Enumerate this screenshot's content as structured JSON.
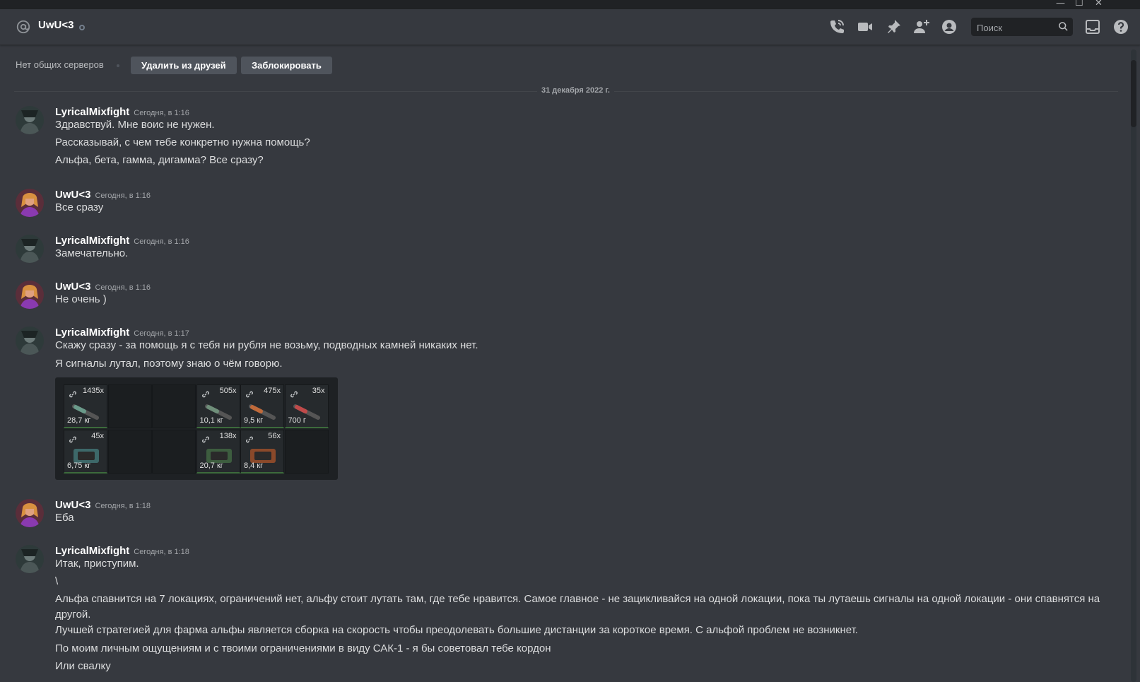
{
  "window": {
    "minimize": "—",
    "maximize": "☐",
    "close": "✕"
  },
  "header": {
    "channel_name": "UwU<3",
    "search_placeholder": "Поиск",
    "icons": [
      "at-icon",
      "call-icon",
      "video-icon",
      "pin-icon",
      "add-friend-icon",
      "profile-icon",
      "search-icon",
      "inbox-icon",
      "help-icon"
    ]
  },
  "profile_bar": {
    "no_servers": "Нет общих серверов",
    "remove_friend": "Удалить из друзей",
    "block": "Заблокировать"
  },
  "date_divider": "31 декабря 2022 г.",
  "messages": [
    {
      "author": "LyricalMixfight",
      "timestamp": "Сегодня, в 1:16",
      "lines": [
        "Здравствуй. Мне воис не нужен.",
        "Рассказывай, с чем тебе конкретно нужна помощь?",
        "Альфа, бета, гамма, дигамма? Все сразу?"
      ]
    },
    {
      "author": "UwU<3",
      "timestamp": "Сегодня, в 1:16",
      "lines": [
        "Все сразу"
      ]
    },
    {
      "author": "LyricalMixfight",
      "timestamp": "Сегодня, в 1:16",
      "lines": [
        "Замечательно."
      ]
    },
    {
      "author": "UwU<3",
      "timestamp": "Сегодня, в 1:16",
      "lines": [
        "Не очень )"
      ]
    },
    {
      "author": "LyricalMixfight",
      "timestamp": "Сегодня, в 1:17",
      "lines": [
        "Скажу сразу - за помощь я с тебя ни рубля не возьму, подводных камней никаких нет.",
        "Я сигналы лутал, поэтому знаю о чём говорю."
      ]
    },
    {
      "author": "UwU<3",
      "timestamp": "Сегодня, в 1:18",
      "lines": [
        "Еба"
      ]
    },
    {
      "author": "LyricalMixfight",
      "timestamp": "Сегодня, в 1:18",
      "lines": [
        "Итак, приступим.",
        "\\",
        "Альфа спавнится на 7 локациях, ограничений нет, альфу стоит лутать там, где тебе нравится. Самое главное - не зацикливайся на одной локации, пока ты лутаешь сигналы на одной локации - они спавнятся на другой.",
        "Лучшей стратегией для фарма альфы является сборка на скорость чтобы преодолевать большие дистанции за короткое время. С альфой проблем не возникнет.",
        "По моим личным ощущениям и с твоими ограничениями в виду САК-1 - я бы советовал тебе кордон",
        "Или свалку"
      ]
    }
  ],
  "inventory": {
    "row1": [
      {
        "count": "1435x",
        "weight": "28,7 кг",
        "color": "#6a9a8a"
      },
      {
        "empty": true
      },
      {
        "empty": true
      },
      {
        "count": "505x",
        "weight": "10,1 кг",
        "color": "#6f8f7a"
      },
      {
        "count": "475x",
        "weight": "9,5 кг",
        "color": "#c06a3a"
      },
      {
        "count": "35x",
        "weight": "700 г",
        "color": "#c04a4a"
      }
    ],
    "row2": [
      {
        "count": "45x",
        "weight": "6,75 кг",
        "color": "#4a8a8a"
      },
      {
        "empty": true
      },
      {
        "empty": true
      },
      {
        "count": "138x",
        "weight": "20,7 кг",
        "color": "#4a7a4a"
      },
      {
        "count": "56x",
        "weight": "8,4 кг",
        "color": "#c05a2a"
      },
      {
        "empty": true
      }
    ]
  },
  "colors": {
    "background": "#36393f",
    "header": "#36393f",
    "button": "#4f545c",
    "username": "#ffffff",
    "text": "#dcddde"
  }
}
